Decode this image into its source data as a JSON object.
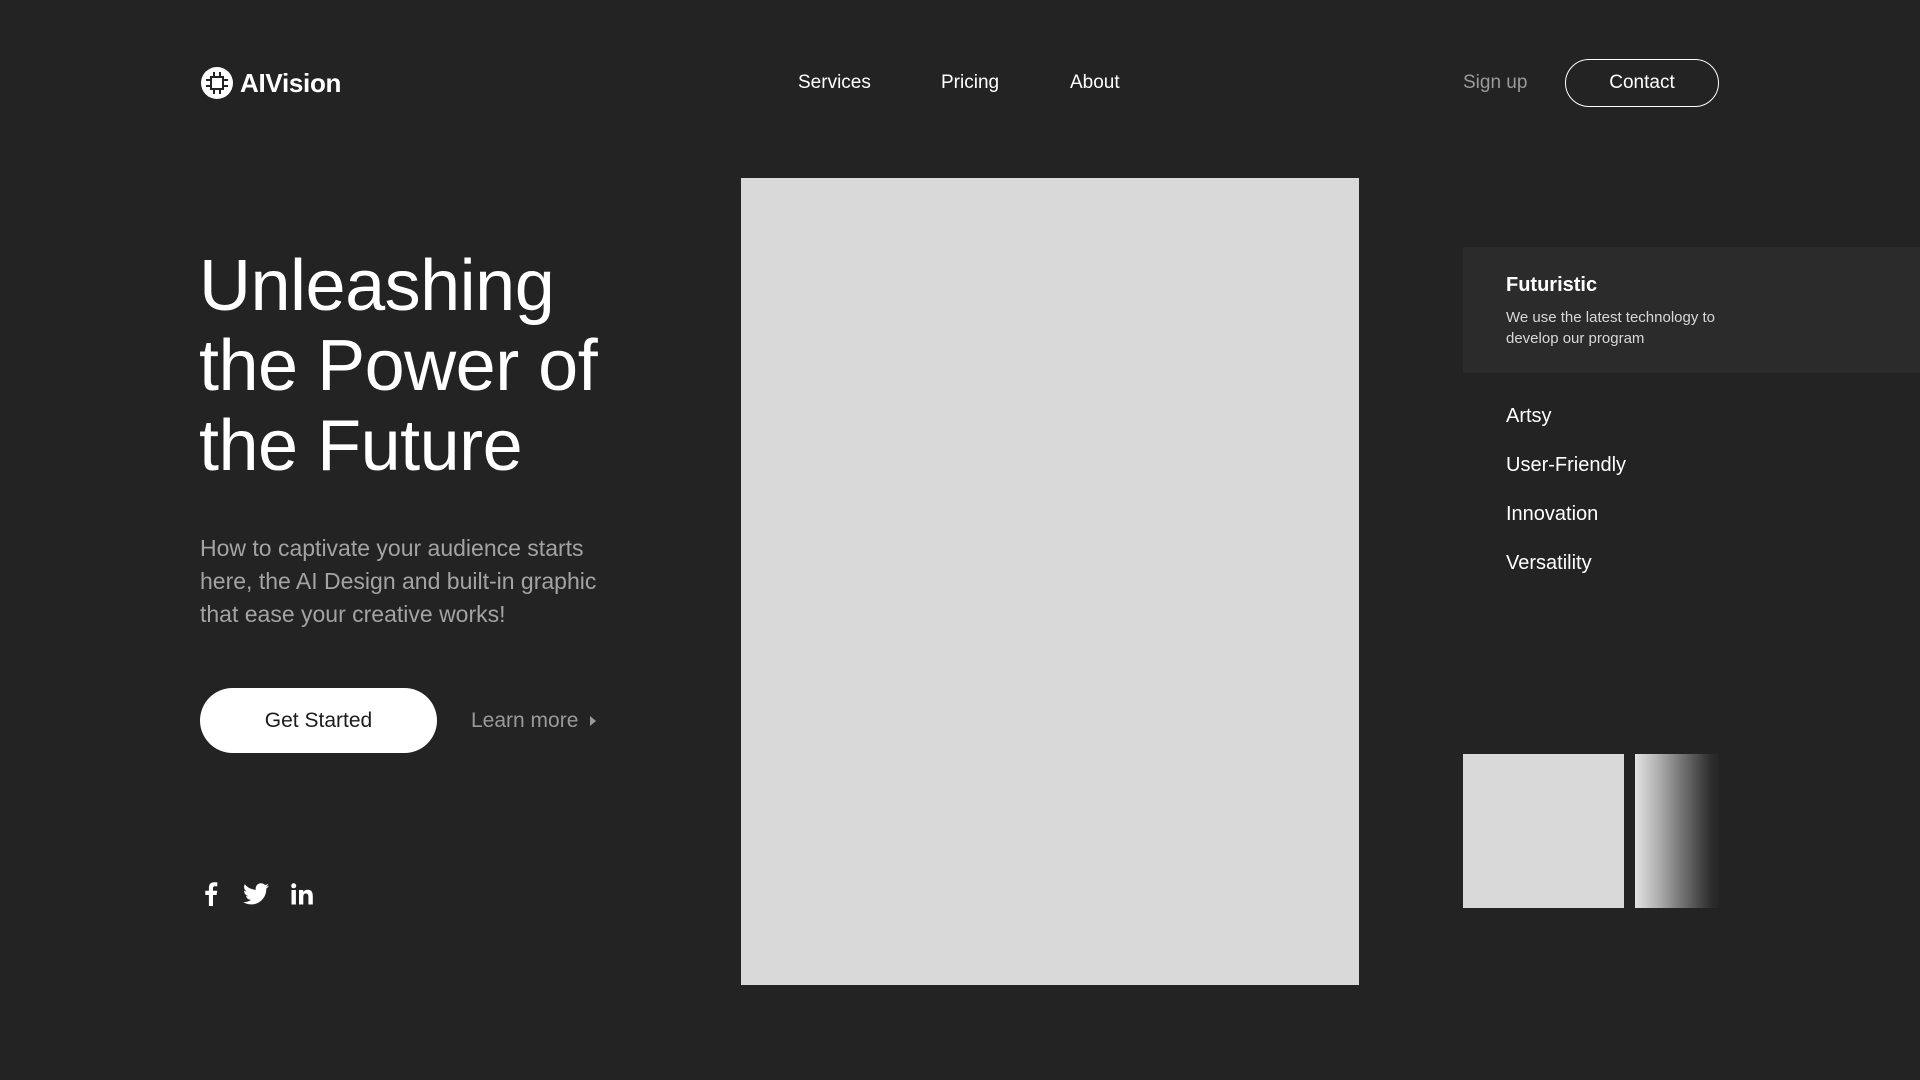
{
  "header": {
    "brand": "AIVision",
    "nav": [
      "Services",
      "Pricing",
      "About"
    ],
    "signup_label": "Sign up",
    "contact_label": "Contact"
  },
  "hero": {
    "title_lines": [
      "Unleashing",
      "the Power of",
      "the Future"
    ],
    "description": "How to captivate your audience starts here, the AI Design and built-in graphic that ease your creative works!",
    "primary_cta": "Get Started",
    "secondary_cta": "Learn more"
  },
  "socials": [
    "facebook-icon",
    "twitter-icon",
    "linkedin-icon"
  ],
  "features": {
    "active": {
      "title": "Futuristic",
      "description": "We use the latest technology to develop our program"
    },
    "items": [
      "Artsy",
      "User-Friendly",
      "Innovation",
      "Versatility"
    ]
  },
  "colors": {
    "background": "#232323",
    "active_panel": "#2b2b2b",
    "placeholder": "#d9d9d9",
    "muted_text": "#9a9a9a",
    "primary_button": "#ffffff"
  }
}
